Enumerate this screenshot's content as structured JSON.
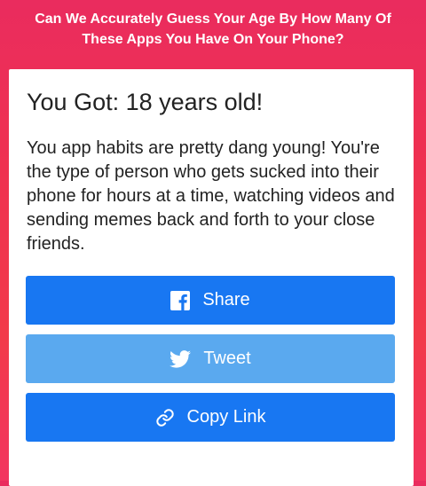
{
  "quiz": {
    "title_line1": "Can We Accurately Guess Your Age By How Many Of",
    "title_line2": "These Apps You Have On Your Phone?"
  },
  "result": {
    "heading": "You Got: 18 years old!",
    "description": "You app habits are pretty dang young! You're the type of person who gets sucked into their phone for hours at a time, watching videos and sending memes back and forth to your close friends."
  },
  "buttons": {
    "share": {
      "label": "Share",
      "icon": "facebook-icon"
    },
    "tweet": {
      "label": "Tweet",
      "icon": "twitter-icon"
    },
    "copy": {
      "label": "Copy Link",
      "icon": "link-icon"
    }
  },
  "colors": {
    "background": "#ef3150",
    "share_button": "#1877f2",
    "tweet_button": "#5aa9ef",
    "copy_button": "#1877f2"
  }
}
